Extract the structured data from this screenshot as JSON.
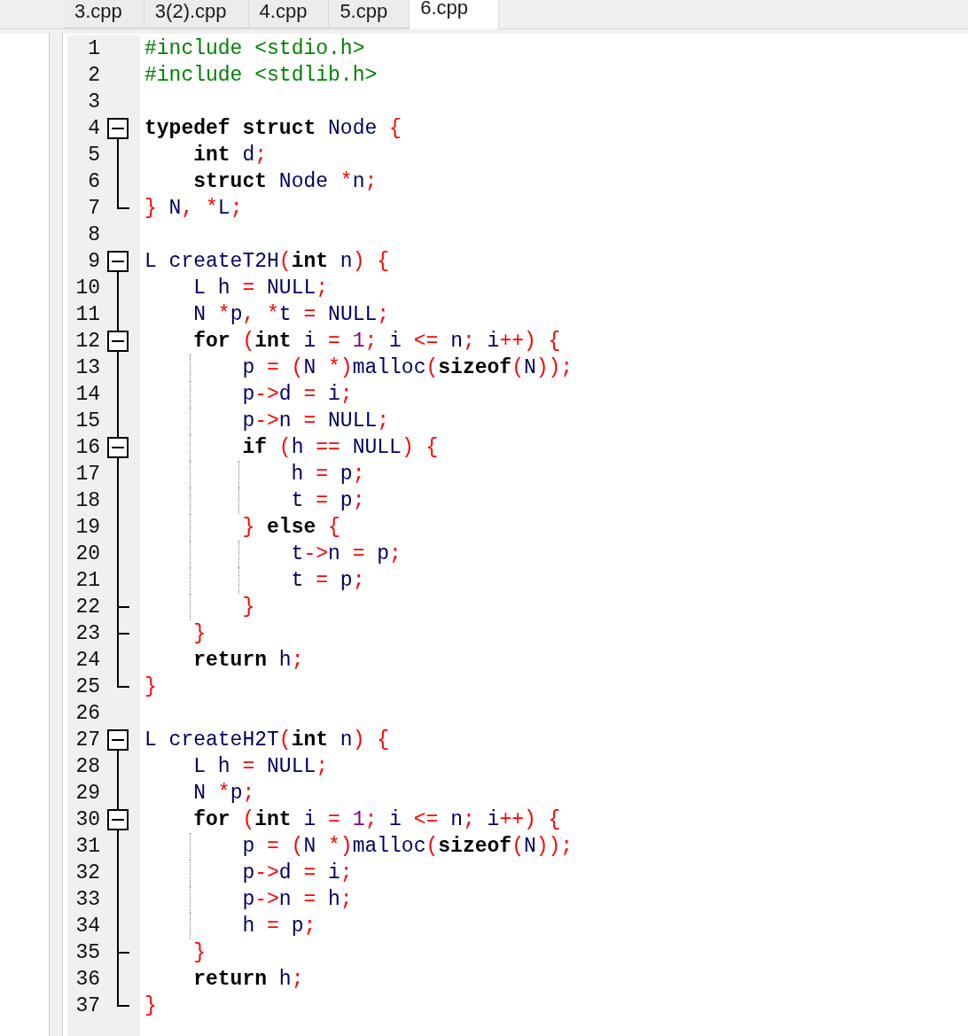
{
  "tabs": [
    {
      "label": "3.cpp",
      "selected": false
    },
    {
      "label": "3(2).cpp",
      "selected": false
    },
    {
      "label": "4.cpp",
      "selected": false
    },
    {
      "label": "5.cpp",
      "selected": false
    },
    {
      "label": "6.cpp",
      "selected": true
    }
  ],
  "editor": {
    "lines": [
      {
        "number": "1",
        "kind": "plain",
        "tokens": [
          {
            "kind": "preprocessor",
            "text": "#include <stdio.h>"
          }
        ]
      },
      {
        "number": "2",
        "kind": "plain",
        "tokens": [
          {
            "kind": "preprocessor",
            "text": "#include <stdlib.h>"
          }
        ]
      },
      {
        "number": "3",
        "kind": "plain"
      },
      {
        "number": "4",
        "kind": "opener",
        "expanded": true,
        "tokens": [
          {
            "kind": "keyword",
            "text": "typedef struct"
          },
          {
            "kind": "identifier",
            "text": " Node "
          },
          {
            "kind": "symbol",
            "text": "{"
          }
        ]
      },
      {
        "number": "5",
        "kind": "plain",
        "tokens": [
          {
            "kind": "keyword",
            "text": "    int"
          },
          {
            "kind": "identifier",
            "text": " d"
          },
          {
            "kind": "symbol",
            "text": ";"
          }
        ]
      },
      {
        "number": "6",
        "kind": "plain",
        "tokens": [
          {
            "kind": "keyword",
            "text": "    struct"
          },
          {
            "kind": "identifier",
            "text": " Node "
          },
          {
            "kind": "symbol",
            "text": "*"
          },
          {
            "kind": "identifier",
            "text": "n"
          },
          {
            "kind": "symbol",
            "text": ";"
          }
        ]
      },
      {
        "number": "7",
        "kind": "closer",
        "tokens": [
          {
            "kind": "symbol",
            "text": "}"
          },
          {
            "kind": "identifier",
            "text": " N"
          },
          {
            "kind": "symbol",
            "text": ", *"
          },
          {
            "kind": "identifier",
            "text": "L"
          },
          {
            "kind": "symbol",
            "text": ";"
          }
        ]
      },
      {
        "number": "8",
        "kind": "plain"
      },
      {
        "number": "9",
        "kind": "opener",
        "expanded": true,
        "tokens": [
          {
            "kind": "identifier",
            "text": "L createT2H"
          },
          {
            "kind": "symbol",
            "text": "("
          },
          {
            "kind": "keyword",
            "text": "int"
          },
          {
            "kind": "identifier",
            "text": " n"
          },
          {
            "kind": "symbol",
            "text": ") {"
          }
        ]
      },
      {
        "number": "10",
        "kind": "plain",
        "tokens": [
          {
            "kind": "identifier",
            "text": "    L h "
          },
          {
            "kind": "symbol",
            "text": "="
          },
          {
            "kind": "identifier",
            "text": " NULL"
          },
          {
            "kind": "symbol",
            "text": ";"
          }
        ]
      },
      {
        "number": "11",
        "kind": "plain",
        "tokens": [
          {
            "kind": "identifier",
            "text": "    N "
          },
          {
            "kind": "symbol",
            "text": "*"
          },
          {
            "kind": "identifier",
            "text": "p"
          },
          {
            "kind": "symbol",
            "text": ", *"
          },
          {
            "kind": "identifier",
            "text": "t "
          },
          {
            "kind": "symbol",
            "text": "="
          },
          {
            "kind": "identifier",
            "text": " NULL"
          },
          {
            "kind": "symbol",
            "text": ";"
          }
        ]
      },
      {
        "number": "12",
        "kind": "opener",
        "expanded": true,
        "tokens": [
          {
            "kind": "keyword",
            "text": "    for "
          },
          {
            "kind": "symbol",
            "text": "("
          },
          {
            "kind": "keyword",
            "text": "int"
          },
          {
            "kind": "identifier",
            "text": " i "
          },
          {
            "kind": "symbol",
            "text": "="
          },
          {
            "kind": "number",
            "text": " 1"
          },
          {
            "kind": "symbol",
            "text": ";"
          },
          {
            "kind": "identifier",
            "text": " i "
          },
          {
            "kind": "symbol",
            "text": "<="
          },
          {
            "kind": "identifier",
            "text": " n"
          },
          {
            "kind": "symbol",
            "text": ";"
          },
          {
            "kind": "identifier",
            "text": " i"
          },
          {
            "kind": "symbol",
            "text": "++) {"
          }
        ]
      },
      {
        "number": "13",
        "kind": "plain",
        "tokens": [
          {
            "kind": "identifier",
            "text": "        p "
          },
          {
            "kind": "symbol",
            "text": "= ("
          },
          {
            "kind": "identifier",
            "text": "N "
          },
          {
            "kind": "symbol",
            "text": "*)"
          },
          {
            "kind": "identifier",
            "text": "malloc"
          },
          {
            "kind": "symbol",
            "text": "("
          },
          {
            "kind": "keyword",
            "text": "sizeof"
          },
          {
            "kind": "symbol",
            "text": "("
          },
          {
            "kind": "identifier",
            "text": "N"
          },
          {
            "kind": "symbol",
            "text": "));"
          }
        ]
      },
      {
        "number": "14",
        "kind": "plain",
        "tokens": [
          {
            "kind": "identifier",
            "text": "        p"
          },
          {
            "kind": "symbol",
            "text": "->"
          },
          {
            "kind": "identifier",
            "text": "d "
          },
          {
            "kind": "symbol",
            "text": "="
          },
          {
            "kind": "identifier",
            "text": " i"
          },
          {
            "kind": "symbol",
            "text": ";"
          }
        ]
      },
      {
        "number": "15",
        "kind": "plain",
        "tokens": [
          {
            "kind": "identifier",
            "text": "        p"
          },
          {
            "kind": "symbol",
            "text": "->"
          },
          {
            "kind": "identifier",
            "text": "n "
          },
          {
            "kind": "symbol",
            "text": "="
          },
          {
            "kind": "identifier",
            "text": " NULL"
          },
          {
            "kind": "symbol",
            "text": ";"
          }
        ]
      },
      {
        "number": "16",
        "kind": "opener",
        "expanded": true,
        "tokens": [
          {
            "kind": "keyword",
            "text": "        if "
          },
          {
            "kind": "symbol",
            "text": "("
          },
          {
            "kind": "identifier",
            "text": "h "
          },
          {
            "kind": "symbol",
            "text": "=="
          },
          {
            "kind": "identifier",
            "text": " NULL"
          },
          {
            "kind": "symbol",
            "text": ") {"
          }
        ]
      },
      {
        "number": "17",
        "kind": "plain",
        "tokens": [
          {
            "kind": "identifier",
            "text": "            h "
          },
          {
            "kind": "symbol",
            "text": "="
          },
          {
            "kind": "identifier",
            "text": " p"
          },
          {
            "kind": "symbol",
            "text": ";"
          }
        ]
      },
      {
        "number": "18",
        "kind": "plain",
        "tokens": [
          {
            "kind": "identifier",
            "text": "            t "
          },
          {
            "kind": "symbol",
            "text": "="
          },
          {
            "kind": "identifier",
            "text": " p"
          },
          {
            "kind": "symbol",
            "text": ";"
          }
        ]
      },
      {
        "number": "19",
        "kind": "plain",
        "tokens": [
          {
            "kind": "symbol",
            "text": "        }"
          },
          {
            "kind": "keyword",
            "text": " else "
          },
          {
            "kind": "symbol",
            "text": "{"
          }
        ]
      },
      {
        "number": "20",
        "kind": "plain",
        "tokens": [
          {
            "kind": "identifier",
            "text": "            t"
          },
          {
            "kind": "symbol",
            "text": "->"
          },
          {
            "kind": "identifier",
            "text": "n "
          },
          {
            "kind": "symbol",
            "text": "="
          },
          {
            "kind": "identifier",
            "text": " p"
          },
          {
            "kind": "symbol",
            "text": ";"
          }
        ]
      },
      {
        "number": "21",
        "kind": "plain",
        "tokens": [
          {
            "kind": "identifier",
            "text": "            t "
          },
          {
            "kind": "symbol",
            "text": "="
          },
          {
            "kind": "identifier",
            "text": " p"
          },
          {
            "kind": "symbol",
            "text": ";"
          }
        ]
      },
      {
        "number": "22",
        "kind": "closer",
        "tokens": [
          {
            "kind": "symbol",
            "text": "        }"
          }
        ]
      },
      {
        "number": "23",
        "kind": "closer",
        "tokens": [
          {
            "kind": "symbol",
            "text": "    }"
          }
        ]
      },
      {
        "number": "24",
        "kind": "plain",
        "tokens": [
          {
            "kind": "keyword",
            "text": "    return"
          },
          {
            "kind": "identifier",
            "text": " h"
          },
          {
            "kind": "symbol",
            "text": ";"
          }
        ]
      },
      {
        "number": "25",
        "kind": "closer",
        "tokens": [
          {
            "kind": "symbol",
            "text": "}"
          }
        ]
      },
      {
        "number": "26",
        "kind": "plain"
      },
      {
        "number": "27",
        "kind": "opener",
        "expanded": true,
        "tokens": [
          {
            "kind": "identifier",
            "text": "L createH2T"
          },
          {
            "kind": "symbol",
            "text": "("
          },
          {
            "kind": "keyword",
            "text": "int"
          },
          {
            "kind": "identifier",
            "text": " n"
          },
          {
            "kind": "symbol",
            "text": ") {"
          }
        ]
      },
      {
        "number": "28",
        "kind": "plain",
        "tokens": [
          {
            "kind": "identifier",
            "text": "    L h "
          },
          {
            "kind": "symbol",
            "text": "="
          },
          {
            "kind": "identifier",
            "text": " NULL"
          },
          {
            "kind": "symbol",
            "text": ";"
          }
        ]
      },
      {
        "number": "29",
        "kind": "plain",
        "tokens": [
          {
            "kind": "identifier",
            "text": "    N "
          },
          {
            "kind": "symbol",
            "text": "*"
          },
          {
            "kind": "identifier",
            "text": "p"
          },
          {
            "kind": "symbol",
            "text": ";"
          }
        ]
      },
      {
        "number": "30",
        "kind": "opener",
        "expanded": true,
        "tokens": [
          {
            "kind": "keyword",
            "text": "    for "
          },
          {
            "kind": "symbol",
            "text": "("
          },
          {
            "kind": "keyword",
            "text": "int"
          },
          {
            "kind": "identifier",
            "text": " i "
          },
          {
            "kind": "symbol",
            "text": "="
          },
          {
            "kind": "number",
            "text": " 1"
          },
          {
            "kind": "symbol",
            "text": ";"
          },
          {
            "kind": "identifier",
            "text": " i "
          },
          {
            "kind": "symbol",
            "text": "<="
          },
          {
            "kind": "identifier",
            "text": " n"
          },
          {
            "kind": "symbol",
            "text": ";"
          },
          {
            "kind": "identifier",
            "text": " i"
          },
          {
            "kind": "symbol",
            "text": "++) {"
          }
        ]
      },
      {
        "number": "31",
        "kind": "plain",
        "tokens": [
          {
            "kind": "identifier",
            "text": "        p "
          },
          {
            "kind": "symbol",
            "text": "= ("
          },
          {
            "kind": "identifier",
            "text": "N "
          },
          {
            "kind": "symbol",
            "text": "*)"
          },
          {
            "kind": "identifier",
            "text": "malloc"
          },
          {
            "kind": "symbol",
            "text": "("
          },
          {
            "kind": "keyword",
            "text": "sizeof"
          },
          {
            "kind": "symbol",
            "text": "("
          },
          {
            "kind": "identifier",
            "text": "N"
          },
          {
            "kind": "symbol",
            "text": "));"
          }
        ]
      },
      {
        "number": "32",
        "kind": "plain",
        "tokens": [
          {
            "kind": "identifier",
            "text": "        p"
          },
          {
            "kind": "symbol",
            "text": "->"
          },
          {
            "kind": "identifier",
            "text": "d "
          },
          {
            "kind": "symbol",
            "text": "="
          },
          {
            "kind": "identifier",
            "text": " i"
          },
          {
            "kind": "symbol",
            "text": ";"
          }
        ]
      },
      {
        "number": "33",
        "kind": "plain",
        "tokens": [
          {
            "kind": "identifier",
            "text": "        p"
          },
          {
            "kind": "symbol",
            "text": "->"
          },
          {
            "kind": "identifier",
            "text": "n "
          },
          {
            "kind": "symbol",
            "text": "="
          },
          {
            "kind": "identifier",
            "text": " h"
          },
          {
            "kind": "symbol",
            "text": ";"
          }
        ]
      },
      {
        "number": "34",
        "kind": "plain",
        "tokens": [
          {
            "kind": "identifier",
            "text": "        h "
          },
          {
            "kind": "symbol",
            "text": "="
          },
          {
            "kind": "identifier",
            "text": " p"
          },
          {
            "kind": "symbol",
            "text": ";"
          }
        ]
      },
      {
        "number": "35",
        "kind": "closer",
        "tokens": [
          {
            "kind": "symbol",
            "text": "    }"
          }
        ]
      },
      {
        "number": "36",
        "kind": "plain",
        "tokens": [
          {
            "kind": "keyword",
            "text": "    return"
          },
          {
            "kind": "identifier",
            "text": " h"
          },
          {
            "kind": "symbol",
            "text": ";"
          }
        ]
      },
      {
        "number": "37",
        "kind": "closer",
        "tokens": [
          {
            "kind": "symbol",
            "text": "}"
          }
        ]
      }
    ]
  }
}
